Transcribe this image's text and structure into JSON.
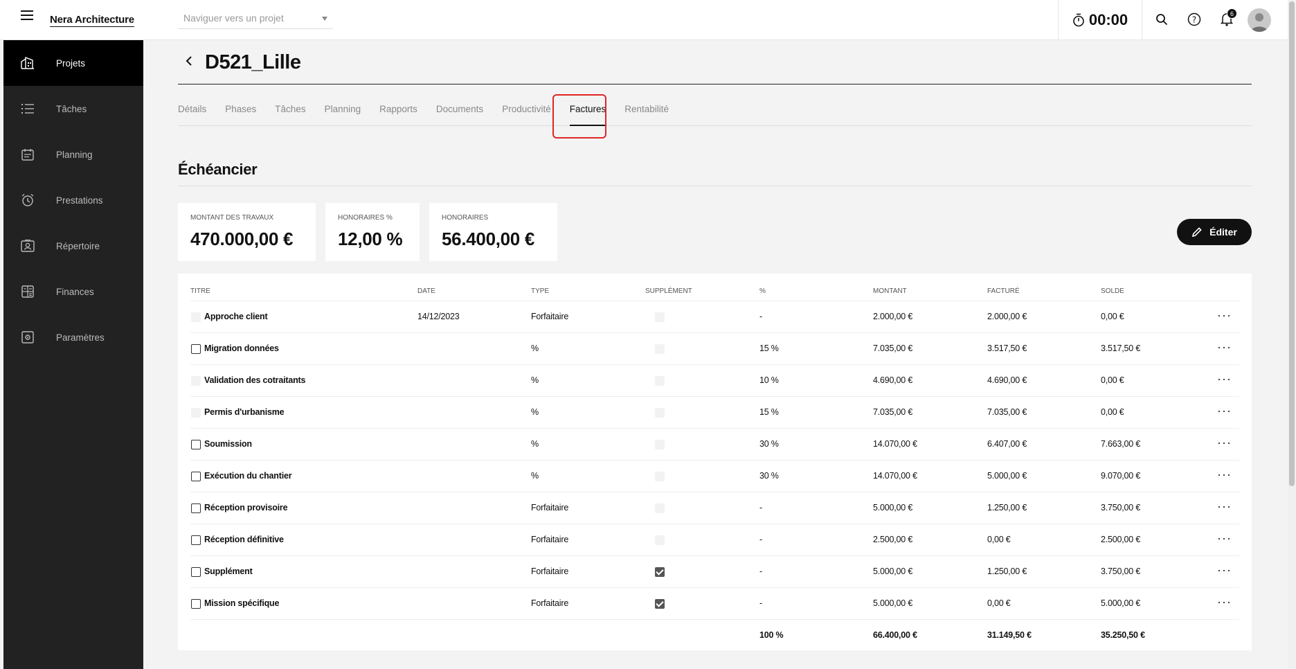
{
  "topbar": {
    "brand": "Nera Architecture",
    "project_placeholder": "Naviguer vers un projet",
    "timer": "00:00",
    "notification_count": "6"
  },
  "sidebar": {
    "items": [
      {
        "label": "Projets",
        "icon": "building-icon"
      },
      {
        "label": "Tâches",
        "icon": "list-icon"
      },
      {
        "label": "Planning",
        "icon": "calendar-icon"
      },
      {
        "label": "Prestations",
        "icon": "alarm-clock-icon"
      },
      {
        "label": "Répertoire",
        "icon": "contact-card-icon"
      },
      {
        "label": "Finances",
        "icon": "calculator-icon"
      },
      {
        "label": "Paramètres",
        "icon": "settings-icon"
      }
    ]
  },
  "page": {
    "title": "D521_Lille",
    "tabs": [
      "Détails",
      "Phases",
      "Tâches",
      "Planning",
      "Rapports",
      "Documents",
      "Productivité",
      "Factures",
      "Rentabilité"
    ],
    "active_tab": "Factures",
    "section_title": "Échéancier",
    "edit_label": "Éditer"
  },
  "kpis": [
    {
      "label": "MONTANT DES TRAVAUX",
      "value": "470.000,00 €"
    },
    {
      "label": "HONORAIRES %",
      "value": "12,00 %"
    },
    {
      "label": "HONORAIRES",
      "value": "56.400,00 €"
    }
  ],
  "table": {
    "headers": [
      "TITRE",
      "DATE",
      "TYPE",
      "SUPPLÉMENT",
      "%",
      "MONTANT",
      "FACTURÉ",
      "SOLDE"
    ],
    "rows": [
      {
        "title": "Approche client",
        "date": "14/12/2023",
        "type": "Forfaitaire",
        "supplement": false,
        "pct": "-",
        "montant": "2.000,00 €",
        "facture": "2.000,00 €",
        "solde": "0,00 €",
        "selectable": false
      },
      {
        "title": "Migration données",
        "date": "",
        "type": "%",
        "supplement": false,
        "pct": "15 %",
        "montant": "7.035,00 €",
        "facture": "3.517,50 €",
        "solde": "3.517,50 €",
        "selectable": true
      },
      {
        "title": "Validation des cotraitants",
        "date": "",
        "type": "%",
        "supplement": false,
        "pct": "10 %",
        "montant": "4.690,00 €",
        "facture": "4.690,00 €",
        "solde": "0,00 €",
        "selectable": false
      },
      {
        "title": "Permis d'urbanisme",
        "date": "",
        "type": "%",
        "supplement": false,
        "pct": "15 %",
        "montant": "7.035,00 €",
        "facture": "7.035,00 €",
        "solde": "0,00 €",
        "selectable": false
      },
      {
        "title": "Soumission",
        "date": "",
        "type": "%",
        "supplement": false,
        "pct": "30 %",
        "montant": "14.070,00 €",
        "facture": "6.407,00 €",
        "solde": "7.663,00 €",
        "selectable": true
      },
      {
        "title": "Exécution du chantier",
        "date": "",
        "type": "%",
        "supplement": false,
        "pct": "30 %",
        "montant": "14.070,00 €",
        "facture": "5.000,00 €",
        "solde": "9.070,00 €",
        "selectable": true
      },
      {
        "title": "Réception provisoire",
        "date": "",
        "type": "Forfaitaire",
        "supplement": false,
        "pct": "-",
        "montant": "5.000,00 €",
        "facture": "1.250,00 €",
        "solde": "3.750,00 €",
        "selectable": true
      },
      {
        "title": "Réception définitive",
        "date": "",
        "type": "Forfaitaire",
        "supplement": false,
        "pct": "-",
        "montant": "2.500,00 €",
        "facture": "0,00 €",
        "solde": "2.500,00 €",
        "selectable": true
      },
      {
        "title": "Supplément",
        "date": "",
        "type": "Forfaitaire",
        "supplement": true,
        "pct": "-",
        "montant": "5.000,00 €",
        "facture": "1.250,00 €",
        "solde": "3.750,00 €",
        "selectable": true
      },
      {
        "title": "Mission spécifique",
        "date": "",
        "type": "Forfaitaire",
        "supplement": true,
        "pct": "-",
        "montant": "5.000,00 €",
        "facture": "0,00 €",
        "solde": "5.000,00 €",
        "selectable": true
      }
    ],
    "totals": {
      "pct": "100 %",
      "montant": "66.400,00 €",
      "facture": "31.149,50 €",
      "solde": "35.250,50 €"
    }
  },
  "colors": {
    "accent": "#111111",
    "sidebar_bg": "#222222",
    "highlight": "#e02424"
  }
}
